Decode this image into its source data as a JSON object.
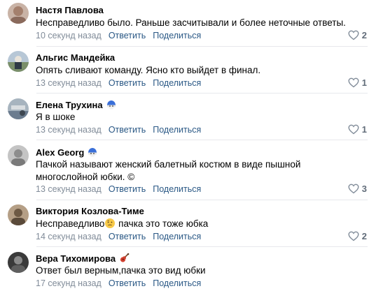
{
  "comments": [
    {
      "author": "Настя Павлова",
      "text": "Несправедливо было. Раньше засчитывали и более неточные ответы.",
      "time": "10 секунд назад",
      "reply_label": "Ответить",
      "share_label": "Поделиться",
      "likes": "2",
      "avatar_color": "#b79b8c"
    },
    {
      "author": "Альгис Мандейка",
      "text": "Опять сливают команду. Ясно кто выйдет в финал.",
      "time": "13 секунд назад",
      "reply_label": "Ответить",
      "share_label": "Поделиться",
      "likes": "1",
      "avatar_color": "#7a8f6a"
    },
    {
      "author": "Елена Трухина",
      "badge": "helmet-emoji",
      "text": "Я в шоке",
      "time": "13 секунд назад",
      "reply_label": "Ответить",
      "share_label": "Поделиться",
      "likes": "1",
      "avatar_color": "#6b7c8f"
    },
    {
      "author": "Alex Georg",
      "badge": "helmet-emoji",
      "text_line1": "Пачкой называют женский балетный костюм в виде пышной",
      "text_line2": "многослойной юбки. ©",
      "time": "13 секунд назад",
      "reply_label": "Ответить",
      "share_label": "Поделиться",
      "likes": "3",
      "avatar_color": "#9a9a9a"
    },
    {
      "author": "Виктория Козлова-Тиме",
      "text_before": "Несправедливо",
      "text_after": " пачка это тоже юбка",
      "inline_emoji": "thinking-face-emoji",
      "time": "14 секунд назад",
      "reply_label": "Ответить",
      "share_label": "Поделиться",
      "likes": "2",
      "avatar_color": "#7d6a52"
    },
    {
      "author": "Вера Тихомирова",
      "badge": "guitar-emoji",
      "text": "Ответ был верным,пачка это вид юбки",
      "time": "17 секунд назад",
      "reply_label": "Ответить",
      "share_label": "Поделиться",
      "avatar_color": "#4d4d4d"
    }
  ],
  "colors": {
    "link": "#2a5885",
    "meta": "#818c99",
    "separator": "#e7e8ec",
    "like": "#626d7a"
  }
}
